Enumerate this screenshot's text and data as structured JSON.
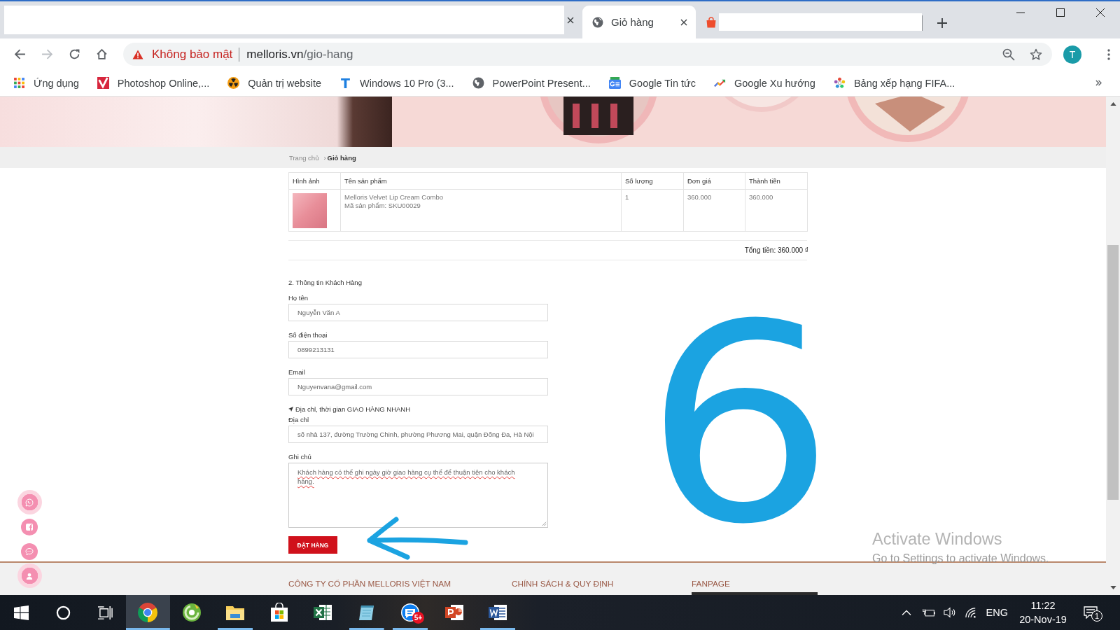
{
  "browser": {
    "tabs": [
      {
        "kind": "redacted",
        "selected": false,
        "closable": true
      },
      {
        "kind": "page",
        "title": "Giỏ hàng",
        "selected": true,
        "closable": true
      },
      {
        "kind": "redacted",
        "selected": false,
        "closable": false
      }
    ],
    "address_bar": {
      "security_label": "Không bảo mật",
      "host": "melloris.vn",
      "path": "/gio-hang"
    },
    "profile_initial": "T",
    "bookmarks": [
      {
        "label": "Ứng dụng"
      },
      {
        "label": "Photoshop Online,..."
      },
      {
        "label": "Quản trị website"
      },
      {
        "label": "Windows 10 Pro (3...",
        "icon_letter": "T"
      },
      {
        "label": "PowerPoint Present..."
      },
      {
        "label": "Google Tin tức"
      },
      {
        "label": "Google Xu hướng"
      },
      {
        "label": "Bảng xếp hạng FIFA..."
      }
    ]
  },
  "page": {
    "breadcrumb": {
      "items": [
        "Trang chủ",
        "Giỏ hàng"
      ],
      "separator": "›"
    },
    "cart": {
      "columns": [
        "Hình ảnh",
        "Tên sản phẩm",
        "Số lượng",
        "Đơn giá",
        "Thành tiền"
      ],
      "rows": [
        {
          "product": "Melloris Velvet Lip Cream Combo",
          "sku": "Mã sản phẩm: SKU00029",
          "quantity": "1",
          "unit_price": "360.000",
          "total": "360.000"
        }
      ],
      "grand_total": "Tổng tiền: 360.000 ₫"
    },
    "customer_form": {
      "title": "2. Thông tin Khách Hàng",
      "fields": [
        {
          "kind": "input",
          "label": "Họ tên",
          "value": "Nguyễn Văn A"
        },
        {
          "kind": "input",
          "label": "Số điện thoại",
          "value": "0899213131"
        },
        {
          "kind": "input",
          "label": "Email",
          "value": "Nguyenvana@gmail.com"
        },
        {
          "kind": "input",
          "note": "Địa chỉ, thời gian GIAO HÀNG NHANH",
          "label": "Địa chỉ",
          "value": "số nhà 137, đường Trường Chinh, phường Phương Mai, quận Đống Đa, Hà Nội"
        },
        {
          "kind": "textarea",
          "label": "Ghi chú",
          "value": "Khách hàng có thể ghi ngày giờ giao hàng cụ thể để thuận tiện cho khách hàng.",
          "spellcheck_flagged": true
        }
      ],
      "submit": "ĐẶT HÀNG"
    },
    "footer": {
      "columns": [
        "CÔNG TY CỔ PHẦN MELLORIS VIỆT NAM",
        "CHÍNH SÁCH & QUY ĐỊNH",
        "FANPAGE"
      ]
    }
  },
  "annotations": [
    {
      "kind": "digit",
      "text": "6"
    },
    {
      "kind": "arrow"
    }
  ],
  "activation_notice": {
    "title": "Activate Windows",
    "subtitle": "Go to Settings to activate Windows."
  },
  "taskbar": {
    "apps": [
      {
        "running": true,
        "selected": true
      },
      {
        "running": false,
        "selected": false
      },
      {
        "running": true,
        "selected": false
      },
      {
        "running": false,
        "selected": false
      },
      {
        "running": false,
        "selected": false
      },
      {
        "running": true,
        "selected": false
      },
      {
        "running": true,
        "selected": false,
        "badge": "5+"
      },
      {
        "running": false,
        "selected": false
      },
      {
        "running": true,
        "selected": false
      }
    ],
    "tray": {
      "language": "ENG",
      "time": "11:22",
      "date": "20-Nov-19",
      "notification_count": "1"
    }
  }
}
